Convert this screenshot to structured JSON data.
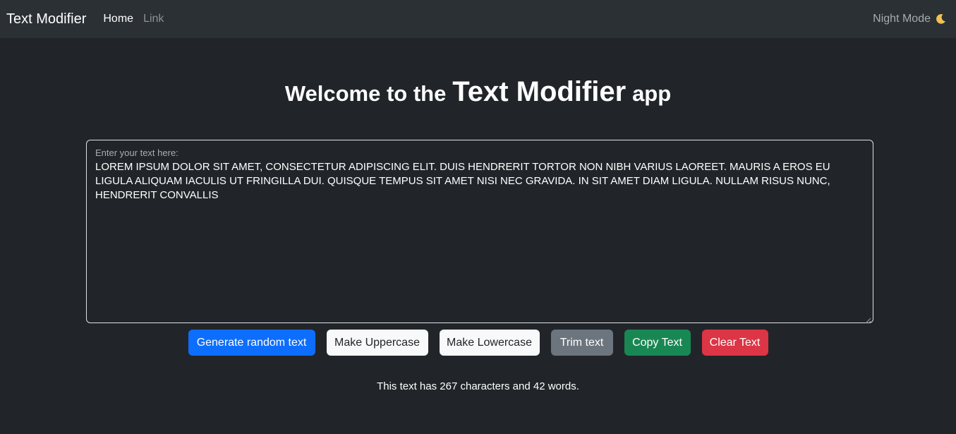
{
  "navbar": {
    "brand": "Text Modifier",
    "links": [
      "Home",
      "Link"
    ],
    "night_mode_label": "Night Mode",
    "night_mode_icon": "moon-icon"
  },
  "heading": {
    "prefix": "Welcome to the",
    "emphasis": "Text Modifier",
    "suffix": "app"
  },
  "textarea": {
    "label": "Enter your text here:",
    "value": "LOREM IPSUM DOLOR SIT AMET, CONSECTETUR ADIPISCING ELIT. DUIS HENDRERIT TORTOR NON NIBH VARIUS LAOREET. MAURIS A EROS EU LIGULA ALIQUAM IACULIS UT FRINGILLA DUI. QUISQUE TEMPUS SIT AMET NISI NEC GRAVIDA. IN SIT AMET DIAM LIGULA. NULLAM RISUS NUNC, HENDRERIT CONVALLIS"
  },
  "buttons": {
    "generate": "Generate random text",
    "uppercase": "Make Uppercase",
    "lowercase": "Make Lowercase",
    "trim": "Trim text",
    "copy": "Copy Text",
    "clear": "Clear Text"
  },
  "summary": "This text has 267 characters and 42 words.",
  "colors": {
    "background": "#212529",
    "navbar": "#2b3035",
    "primary": "#0d6efd",
    "secondary": "#6c757d",
    "success": "#198754",
    "danger": "#dc3545",
    "light": "#f8f9fa"
  }
}
